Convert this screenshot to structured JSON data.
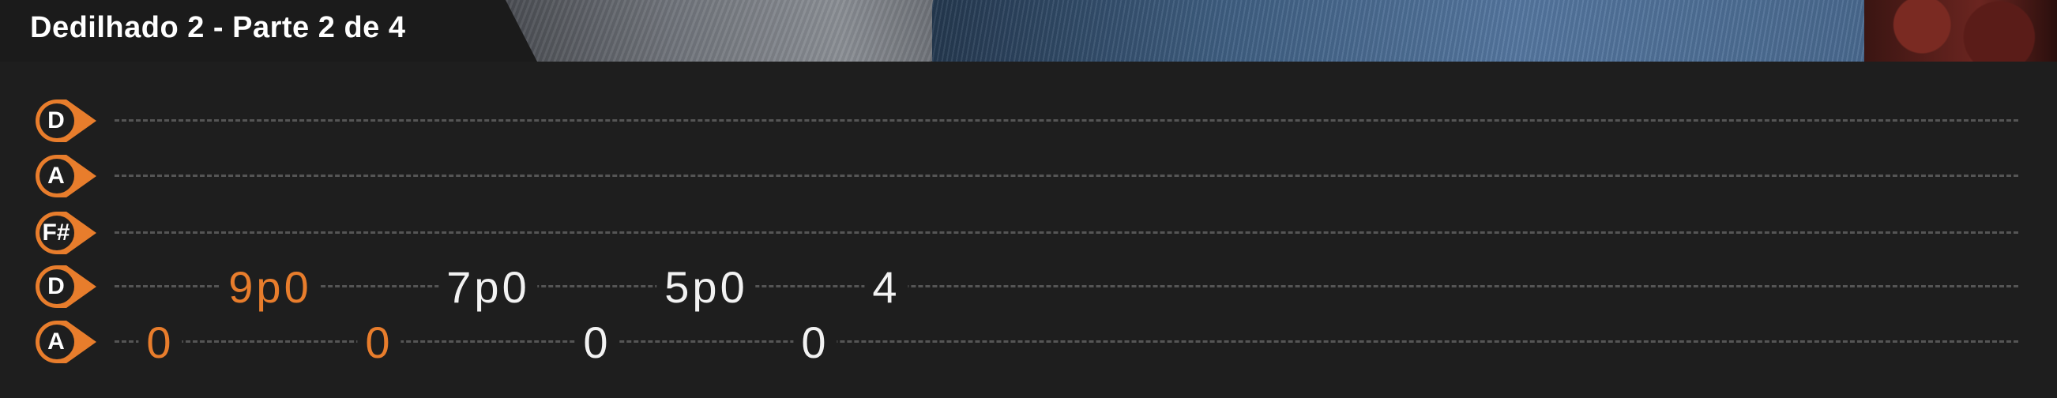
{
  "header": {
    "title": "Dedilhado 2 - Parte 2 de 4"
  },
  "tablature": {
    "strings": [
      {
        "label": "D"
      },
      {
        "label": "A"
      },
      {
        "label": "F#"
      },
      {
        "label": "D"
      },
      {
        "label": "A"
      }
    ],
    "notes": [
      {
        "text": "0",
        "string": 5,
        "state": "played"
      },
      {
        "text": "9p0",
        "string": 4,
        "state": "played"
      },
      {
        "text": "0",
        "string": 5,
        "state": "played"
      },
      {
        "text": "7p0",
        "string": 4,
        "state": "upcoming"
      },
      {
        "text": "0",
        "string": 5,
        "state": "upcoming"
      },
      {
        "text": "5p0",
        "string": 4,
        "state": "upcoming"
      },
      {
        "text": "0",
        "string": 5,
        "state": "upcoming"
      },
      {
        "text": "4",
        "string": 4,
        "state": "upcoming"
      }
    ]
  },
  "colors": {
    "accent": "#e87d2c",
    "background": "#1e1e1e",
    "upcoming_note": "#f2f2f2",
    "string_line": "#555555"
  },
  "icons": {
    "string_marker": "string-tuning-marker-icon"
  }
}
